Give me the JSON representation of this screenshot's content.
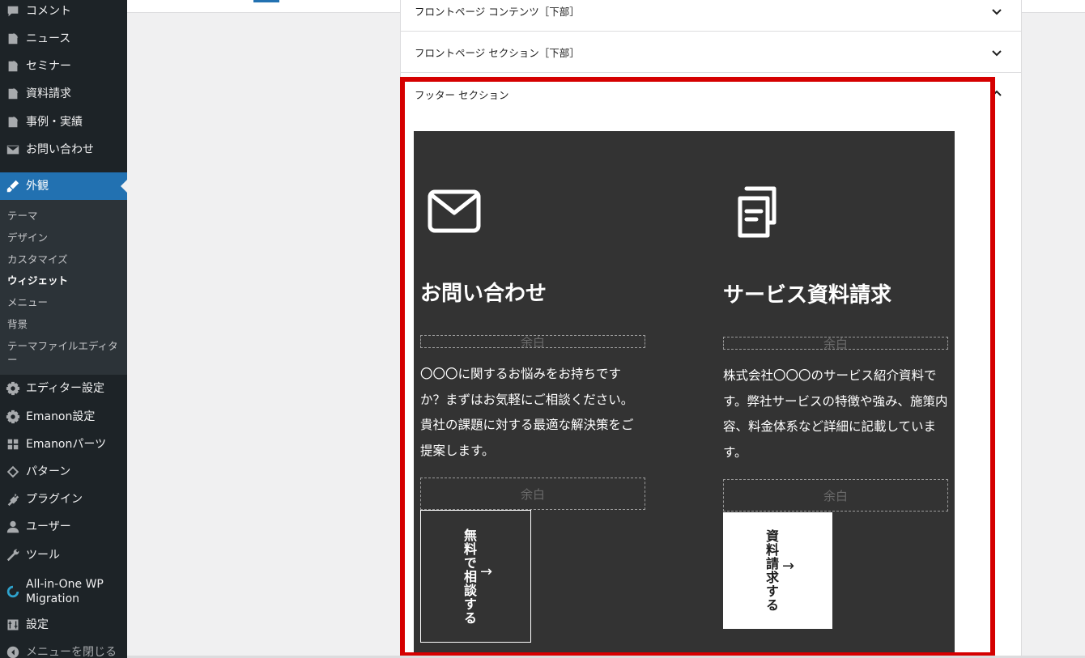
{
  "sidebar": {
    "items": [
      {
        "label": "コメント",
        "icon": "comment-icon"
      },
      {
        "label": "ニュース",
        "icon": "post-icon"
      },
      {
        "label": "セミナー",
        "icon": "post-icon"
      },
      {
        "label": "資料請求",
        "icon": "post-icon"
      },
      {
        "label": "事例・実績",
        "icon": "post-icon"
      },
      {
        "label": "お問い合わせ",
        "icon": "mail-icon"
      },
      {
        "label": "外観",
        "icon": "brush-icon",
        "active": true
      },
      {
        "label": "エディター設定",
        "icon": "gear-icon"
      },
      {
        "label": "Emanon設定",
        "icon": "gear-icon"
      },
      {
        "label": "Emanonパーツ",
        "icon": "grid-icon"
      },
      {
        "label": "パターン",
        "icon": "pattern-icon"
      },
      {
        "label": "プラグイン",
        "icon": "plugin-icon"
      },
      {
        "label": "ユーザー",
        "icon": "user-icon"
      },
      {
        "label": "ツール",
        "icon": "wrench-icon"
      },
      {
        "label": "All-in-One WP Migration",
        "icon": "migration-icon"
      },
      {
        "label": "設定",
        "icon": "settings-icon"
      },
      {
        "label": "メニューを閉じる",
        "icon": "collapse-icon"
      }
    ],
    "submenu": [
      {
        "label": "テーマ"
      },
      {
        "label": "デザイン"
      },
      {
        "label": "カスタマイズ"
      },
      {
        "label": "ウィジェット",
        "current": true
      },
      {
        "label": "メニュー"
      },
      {
        "label": "背景"
      },
      {
        "label": "テーマファイルエディター"
      }
    ]
  },
  "panel": {
    "sections": [
      {
        "label": "フロントページ コンテンツ［下部］",
        "expanded": false
      },
      {
        "label": "フロントページ セクション［下部］",
        "expanded": false
      },
      {
        "label": "フッター セクション",
        "expanded": true
      }
    ]
  },
  "footer": {
    "contact": {
      "icon": "envelope-icon",
      "title": "お問い合わせ",
      "spacer_label": "余白",
      "text": "〇〇〇に関するお悩みをお持ちですか？まずはお気軽にご相談ください。貴社の課題に対する最適な解決策をご提案します。",
      "button_label": "無料で相談する",
      "button_arrow": "→"
    },
    "document": {
      "icon": "documents-icon",
      "title": "サービス資料請求",
      "spacer_label": "余白",
      "text": "株式会社〇〇〇のサービス紹介資料です。弊社サービスの特徴や強み、施策内容、料金体系など詳細に記載しています。",
      "button_label": "資料請求する",
      "button_arrow": "→"
    }
  },
  "colors": {
    "sidebar_bg": "#1d2327",
    "active_blue": "#2271b1",
    "highlight_red": "#d50000",
    "footer_bg": "#333333"
  }
}
